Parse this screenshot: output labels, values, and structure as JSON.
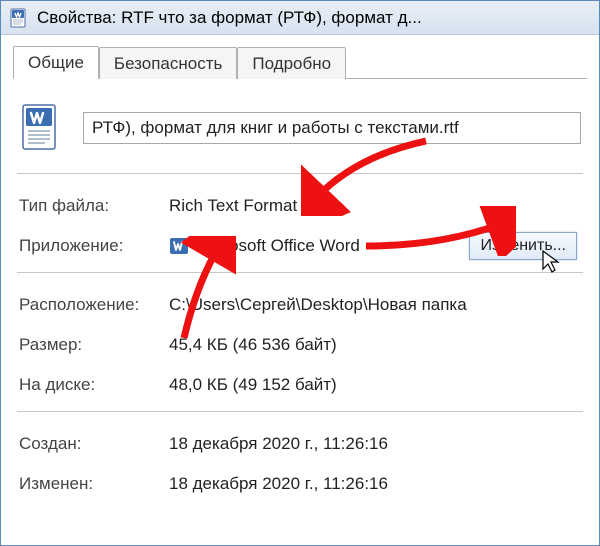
{
  "window": {
    "title": "Свойства: RTF что за формат (РТФ), формат д..."
  },
  "tabs": {
    "general": "Общие",
    "security": "Безопасность",
    "details": "Подробно"
  },
  "file": {
    "name": "РТФ), формат для книг и работы с текстами.rtf"
  },
  "labels": {
    "filetype": "Тип файла:",
    "opens_with": "Приложение:",
    "location": "Расположение:",
    "size": "Размер:",
    "size_on_disk": "На диске:",
    "created": "Создан:",
    "modified": "Изменен:"
  },
  "values": {
    "filetype": "Rich Text Format (.rtf)",
    "opens_with": "Microsoft Office Word",
    "location": "C:\\Users\\Сергей\\Desktop\\Новая папка",
    "size": "45,4 КБ (46 536 байт)",
    "size_on_disk": "48,0 КБ (49 152 байт)",
    "created": "18 декабря 2020 г., 11:26:16",
    "modified": "18 декабря 2020 г., 11:26:16"
  },
  "buttons": {
    "change": "Изменить..."
  }
}
